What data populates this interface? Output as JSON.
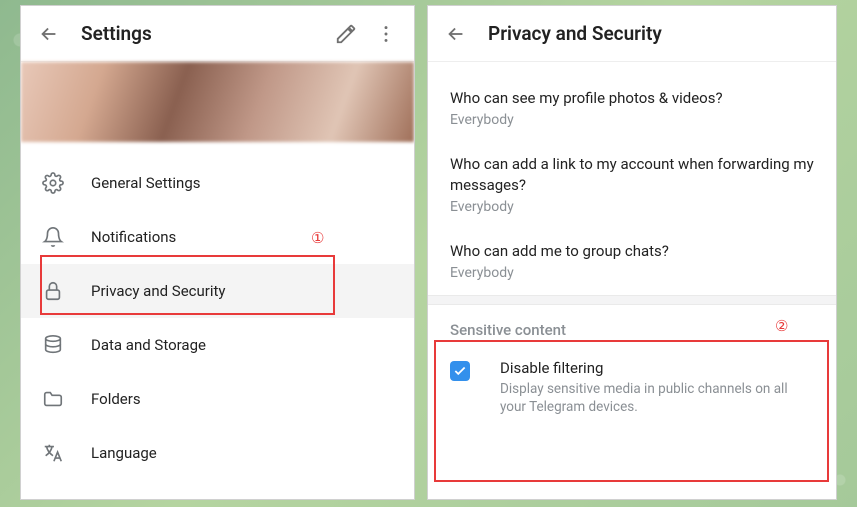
{
  "leftPanel": {
    "title": "Settings",
    "menu": [
      {
        "icon": "gear",
        "label": "General Settings"
      },
      {
        "icon": "bell",
        "label": "Notifications"
      },
      {
        "icon": "lock",
        "label": "Privacy and Security",
        "active": true
      },
      {
        "icon": "db",
        "label": "Data and Storage"
      },
      {
        "icon": "folder",
        "label": "Folders"
      },
      {
        "icon": "lang",
        "label": "Language"
      }
    ]
  },
  "rightPanel": {
    "title": "Privacy and Security",
    "items": [
      {
        "q": "Who can see my profile photos & videos?",
        "a": "Everybody"
      },
      {
        "q": "Who can add a link to my account when forwarding my messages?",
        "a": "Everybody"
      },
      {
        "q": "Who can add me to group chats?",
        "a": "Everybody"
      }
    ],
    "sensitive": {
      "sectionTitle": "Sensitive content",
      "checkbox": {
        "checked": true,
        "title": "Disable filtering",
        "desc": "Display sensitive media in public channels on all your Telegram devices."
      }
    }
  },
  "callouts": {
    "1": "①",
    "2": "②"
  }
}
